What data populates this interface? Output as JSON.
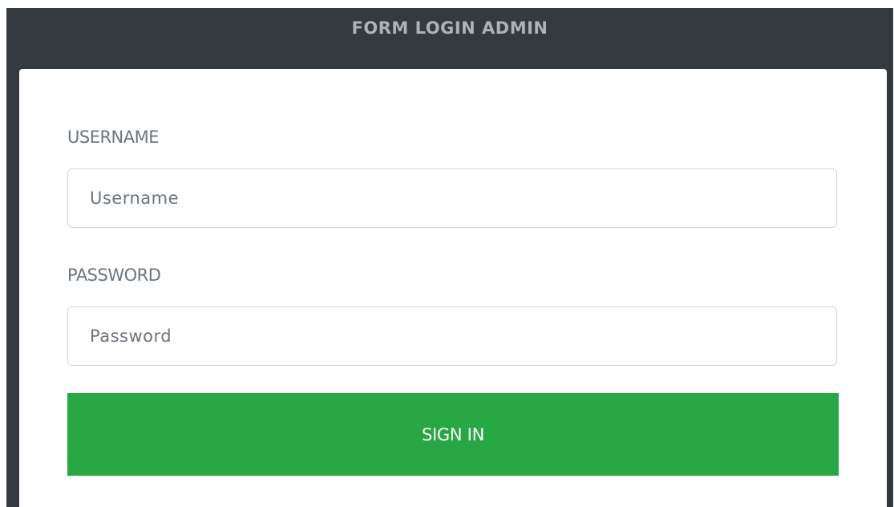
{
  "form": {
    "title": "FORM LOGIN ADMIN",
    "username": {
      "label": "USERNAME",
      "placeholder": "Username",
      "value": ""
    },
    "password": {
      "label": "PASSWORD",
      "placeholder": "Password",
      "value": ""
    },
    "submit_label": "SIGN IN"
  },
  "colors": {
    "header_background": "#343a40",
    "title_text": "#aeb2b7",
    "label_text": "#6c757d",
    "input_border": "#ced4da",
    "button_background": "#28a745",
    "button_text": "#ffffff"
  }
}
